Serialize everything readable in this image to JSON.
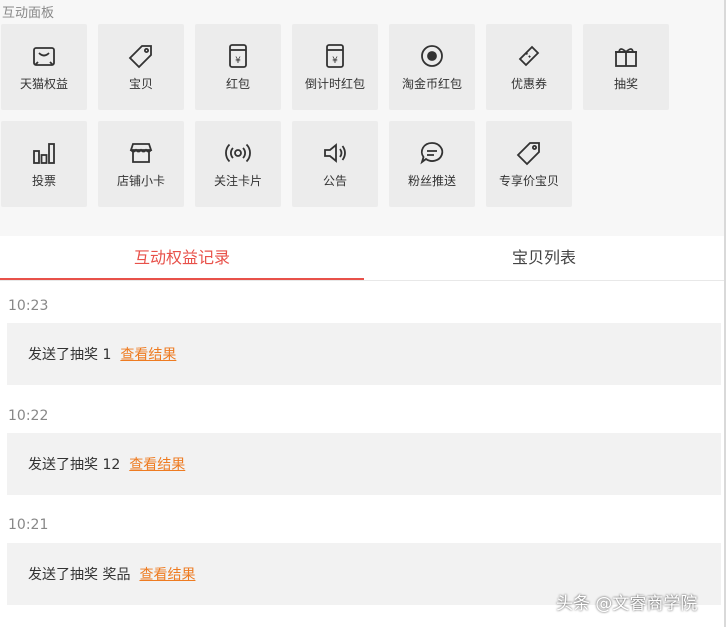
{
  "panel_title": "互动面板",
  "tiles_row1": [
    {
      "label": "天猫权益",
      "icon": "tmall-bag-icon"
    },
    {
      "label": "宝贝",
      "icon": "tag-icon"
    },
    {
      "label": "红包",
      "icon": "red-envelope-icon"
    },
    {
      "label": "倒计时红包",
      "icon": "countdown-envelope-icon"
    },
    {
      "label": "淘金币红包",
      "icon": "gold-coin-icon"
    },
    {
      "label": "优惠券",
      "icon": "coupon-icon"
    },
    {
      "label": "抽奖",
      "icon": "gift-icon"
    }
  ],
  "tiles_row2": [
    {
      "label": "投票",
      "icon": "bar-chart-icon"
    },
    {
      "label": "店铺小卡",
      "icon": "store-icon"
    },
    {
      "label": "关注卡片",
      "icon": "broadcast-icon"
    },
    {
      "label": "公告",
      "icon": "speaker-icon"
    },
    {
      "label": "粉丝推送",
      "icon": "chat-bubble-icon"
    },
    {
      "label": "专享价宝贝",
      "icon": "price-tag-icon"
    }
  ],
  "tabs": {
    "records": "互动权益记录",
    "items": "宝贝列表",
    "active": "records"
  },
  "records": [
    {
      "time": "10:23",
      "text": "发送了抽奖 1",
      "link": "查看结果"
    },
    {
      "time": "10:22",
      "text": "发送了抽奖 12",
      "link": "查看结果"
    },
    {
      "time": "10:21",
      "text": "发送了抽奖 奖品",
      "link": "查看结果"
    }
  ],
  "watermark": "头条 @文睿商学院",
  "colors": {
    "accent": "#e8514a",
    "link": "#ee7b21"
  }
}
